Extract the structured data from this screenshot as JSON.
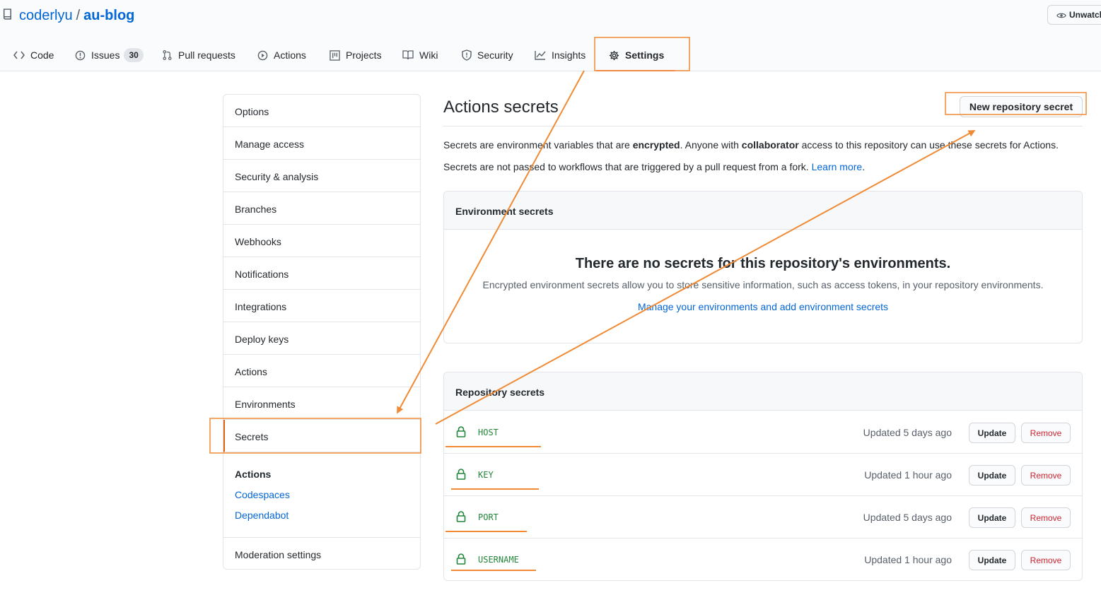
{
  "header": {
    "owner": "coderlyu",
    "separator": "/",
    "repo": "au-blog",
    "unwatch_label": "Unwatch"
  },
  "tabs": [
    {
      "label": "Code",
      "icon": "code-icon"
    },
    {
      "label": "Issues",
      "icon": "issue-icon",
      "counter": "30"
    },
    {
      "label": "Pull requests",
      "icon": "pull-request-icon"
    },
    {
      "label": "Actions",
      "icon": "play-icon"
    },
    {
      "label": "Projects",
      "icon": "project-icon"
    },
    {
      "label": "Wiki",
      "icon": "book-icon"
    },
    {
      "label": "Security",
      "icon": "shield-icon"
    },
    {
      "label": "Insights",
      "icon": "graph-icon"
    },
    {
      "label": "Settings",
      "icon": "gear-icon",
      "selected": true
    }
  ],
  "sidebar": {
    "items": [
      {
        "label": "Options"
      },
      {
        "label": "Manage access"
      },
      {
        "label": "Security & analysis"
      },
      {
        "label": "Branches"
      },
      {
        "label": "Webhooks"
      },
      {
        "label": "Notifications"
      },
      {
        "label": "Integrations"
      },
      {
        "label": "Deploy keys"
      },
      {
        "label": "Actions"
      },
      {
        "label": "Environments"
      },
      {
        "label": "Secrets",
        "selected": true
      }
    ],
    "heading": "Actions",
    "links": [
      {
        "label": "Codespaces"
      },
      {
        "label": "Dependabot"
      }
    ],
    "moderation": "Moderation settings"
  },
  "main": {
    "title": "Actions secrets",
    "new_secret_button": "New repository secret",
    "para1": {
      "t1": "Secrets are environment variables that are ",
      "b1": "encrypted",
      "t2": ". Anyone with ",
      "b2": "collaborator",
      "t3": " access to this repository can use these secrets for Actions."
    },
    "para2": {
      "t1": "Secrets are not passed to workflows that are triggered by a pull request from a fork. ",
      "link": "Learn more",
      "t2": "."
    },
    "env": {
      "header": "Environment secrets",
      "blank_title": "There are no secrets for this repository's environments.",
      "blank_text": "Encrypted environment secrets allow you to store sensitive information, such as access tokens, in your repository environments.",
      "blank_link": "Manage your environments and add environment secrets"
    },
    "repo_secrets": {
      "header": "Repository secrets",
      "update_label": "Update",
      "remove_label": "Remove",
      "rows": [
        {
          "name": "HOST",
          "updated": "Updated 5 days ago"
        },
        {
          "name": "KEY",
          "updated": "Updated 1 hour ago"
        },
        {
          "name": "PORT",
          "updated": "Updated 5 days ago"
        },
        {
          "name": "USERNAME",
          "updated": "Updated 1 hour ago"
        }
      ]
    }
  },
  "colors": {
    "link": "#0366d6",
    "annotation": "#f08a35",
    "secret_name": "#22863a",
    "remove": "#cb2431"
  }
}
